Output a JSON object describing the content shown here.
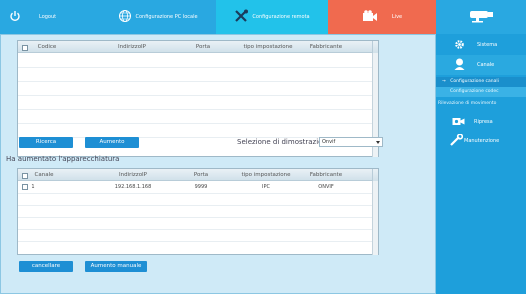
{
  "topbar": {
    "logout": "Logout",
    "pc_config": "Configurazione PC locale",
    "remote_config": "Configurazione remota",
    "live": "Live"
  },
  "top_table": {
    "headers": [
      "Codice",
      "IndirizzoIP",
      "Porta",
      "tipo impostazione",
      "Fabbricante"
    ]
  },
  "search_bar": {
    "search_button": "Ricerca",
    "add_button": "Aumento",
    "protocol_label": "Selezione di dimostrazione",
    "protocol_value": "Onvif"
  },
  "added_section": {
    "title": "Ha aumentato l'apparecchiatura",
    "headers": [
      "Canale",
      "IndirizzoIP",
      "Porta",
      "tipo impostazione",
      "Fabbricante"
    ],
    "rows": [
      {
        "channel": "1",
        "ip": "192.168.1.168",
        "port": "9999",
        "type": "IPC",
        "maker": "ONVIF"
      }
    ],
    "delete_button": "cancellare",
    "manual_add_button": "Aumento manuale"
  },
  "sidebar": {
    "system": "Sistema",
    "channel": "Canale",
    "sub_items": [
      "Configurazione canali",
      "Configurazione codec",
      "Rilevazione di movimento"
    ],
    "record": "Ripresa",
    "maintenance": "Manutenzione"
  },
  "colors": {
    "topbar": "#29a8e1",
    "active_tab": "#22c2ea",
    "live_tab": "#f06a4f",
    "sidebar": "#1e9fdb",
    "button": "#1e8fd4"
  }
}
